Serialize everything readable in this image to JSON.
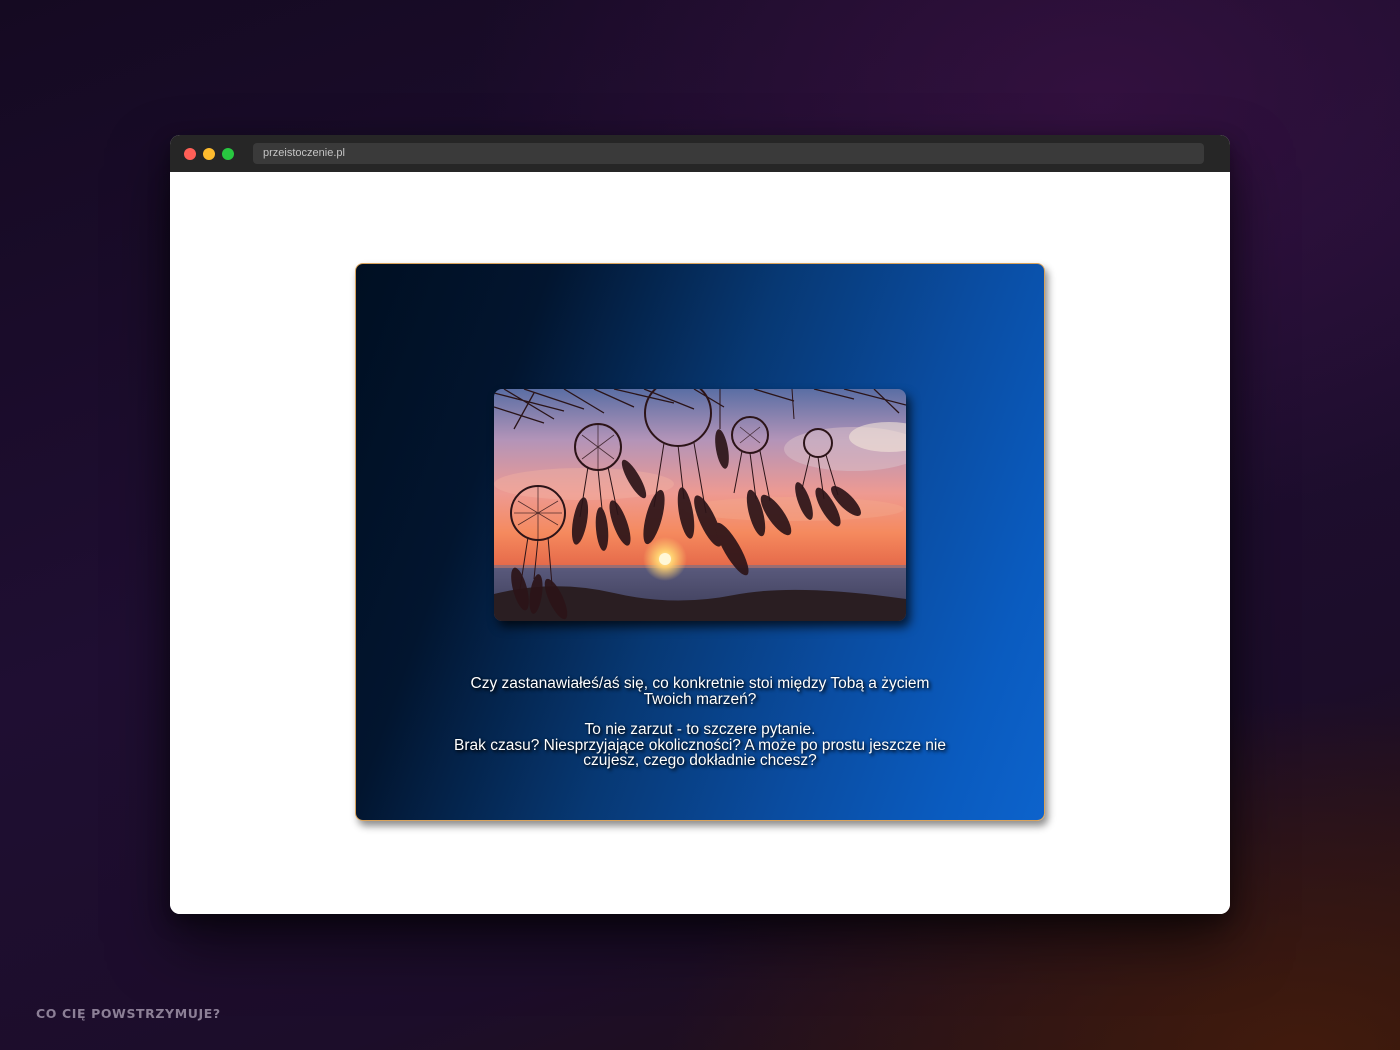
{
  "browser": {
    "url": "przeistoczenie.pl",
    "controls": {
      "close_color": "#ff5f57",
      "minimize_color": "#febc2e",
      "maximize_color": "#28c840"
    }
  },
  "card": {
    "border_color": "#d9a35c",
    "image_icon": "dreamcatcher-sunset-image",
    "lines": [
      "Czy zastanawiałeś/aś się, co konkretnie stoi między Tobą a życiem Twoich marzeń?",
      "To nie zarzut - to szczere pytanie.",
      "Brak czasu? Niesprzyjające okoliczności? A może po prostu jeszcze nie czujesz, czego dokładnie chcesz?"
    ]
  },
  "caption": "CO CIĘ POWSTRZYMUJE?"
}
